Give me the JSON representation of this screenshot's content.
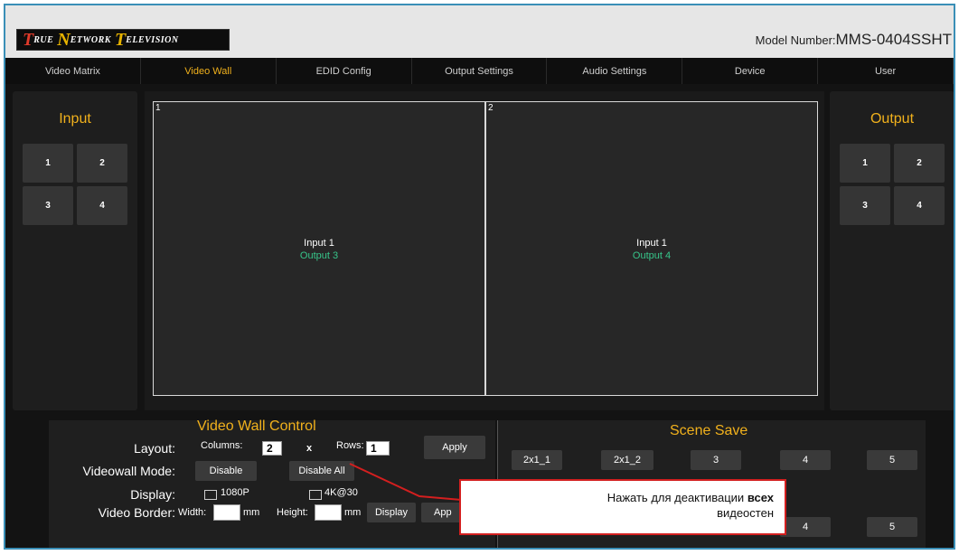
{
  "header": {
    "logo": {
      "t1": "T",
      "w1": "RUE",
      "t2": "N",
      "w2": "ETWORK",
      "t3": "T",
      "w3": "ELEVISION"
    },
    "model_label": "Model Number:",
    "model_value": "MMS-0404SSHT"
  },
  "nav": {
    "items": [
      "Video Matrix",
      "Video Wall",
      "EDID Config",
      "Output Settings",
      "Audio Settings",
      "Device",
      "User"
    ],
    "active": "Video Wall"
  },
  "input_panel": {
    "title": "Input",
    "buttons": [
      "1",
      "2",
      "3",
      "4"
    ]
  },
  "output_panel": {
    "title": "Output",
    "buttons": [
      "1",
      "2",
      "3",
      "4"
    ]
  },
  "screens": [
    {
      "number": "1",
      "input": "Input 1",
      "output": "Output 3"
    },
    {
      "number": "2",
      "input": "Input 1",
      "output": "Output 4"
    }
  ],
  "control": {
    "title": "Video Wall Control",
    "layout_label": "Layout:",
    "columns_label": "Columns:",
    "columns_value": "2",
    "x_label": "x",
    "rows_label": "Rows:",
    "rows_value": "1",
    "apply_label": "Apply",
    "mode_label": "Videowall Mode:",
    "disable_label": "Disable",
    "disable_all_label": "Disable All",
    "display_label": "Display:",
    "opt_1080p": "1080P",
    "opt_4k": "4K@30",
    "border_label": "Video Border:",
    "width_label": "Width:",
    "mm1": "mm",
    "height_label": "Height:",
    "mm2": "mm",
    "display_btn": "Display",
    "apply2_label": "App"
  },
  "scene": {
    "title": "Scene Save",
    "row1": [
      "2x1_1",
      "2x1_2",
      "3",
      "4",
      "5"
    ],
    "row2": [
      "4",
      "5"
    ]
  },
  "callout": {
    "text_pre": "Нажать для деактивации ",
    "text_bold": "всех",
    "text_post": "видеостен"
  },
  "colors": {
    "accent": "#f1b11c",
    "output_green": "#37c58a",
    "callout_red": "#d31f1f",
    "frame_blue": "#3a8fb7"
  }
}
